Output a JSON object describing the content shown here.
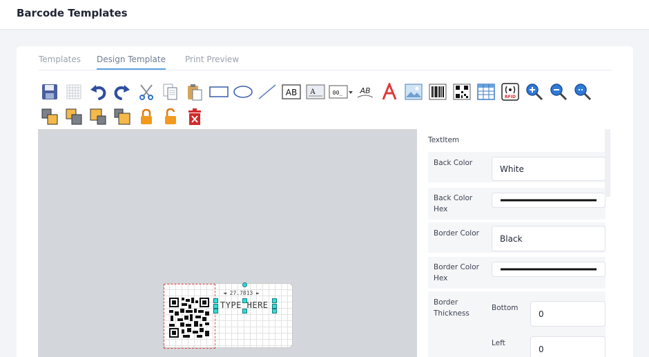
{
  "app": {
    "title": "Barcode Templates"
  },
  "tabs": [
    {
      "label": "Templates"
    },
    {
      "label": "Design Template"
    },
    {
      "label": "Print Preview"
    }
  ],
  "toolbar": {
    "text_ab": "AB",
    "text_a": "A",
    "counter_text": "00_",
    "ab_curved": "AB",
    "rfid_label": "RFID",
    "icons": [
      "save-icon",
      "grid-icon",
      "undo-icon",
      "redo-icon",
      "cut-icon",
      "copy-icon",
      "paste-icon",
      "rectangle-icon",
      "ellipse-icon",
      "line-icon",
      "text-box-icon",
      "text-field-icon",
      "counter-icon",
      "curved-text-icon",
      "font-icon",
      "image-icon",
      "barcode-icon",
      "qrcode-icon",
      "table-icon",
      "rfid-icon",
      "zoom-in-icon",
      "zoom-out-icon",
      "zoom-fit-icon",
      "bring-front-icon",
      "send-back-icon",
      "bring-forward-icon",
      "send-backward-icon",
      "lock-icon",
      "unlock-icon",
      "delete-icon"
    ]
  },
  "canvas": {
    "label_text": "TYPE HERE",
    "dimension_text": "◄ 27.7813 ►"
  },
  "properties": {
    "section": "TextItem",
    "back_color_label": "Back Color",
    "back_color_value": "White",
    "back_color_hex_label": "Back Color Hex",
    "border_color_label": "Border Color",
    "border_color_value": "Black",
    "border_color_hex_label": "Border Color Hex",
    "border_thickness_label": "Border Thickness",
    "bottom_label": "Bottom",
    "bottom_value": "0",
    "left_label": "Left",
    "left_value": "0"
  },
  "colors": {
    "accent": "#5aa1e0",
    "handle": "#33dcd8",
    "canvas_bg": "#d3d6db",
    "guide": "#e14b4b"
  }
}
